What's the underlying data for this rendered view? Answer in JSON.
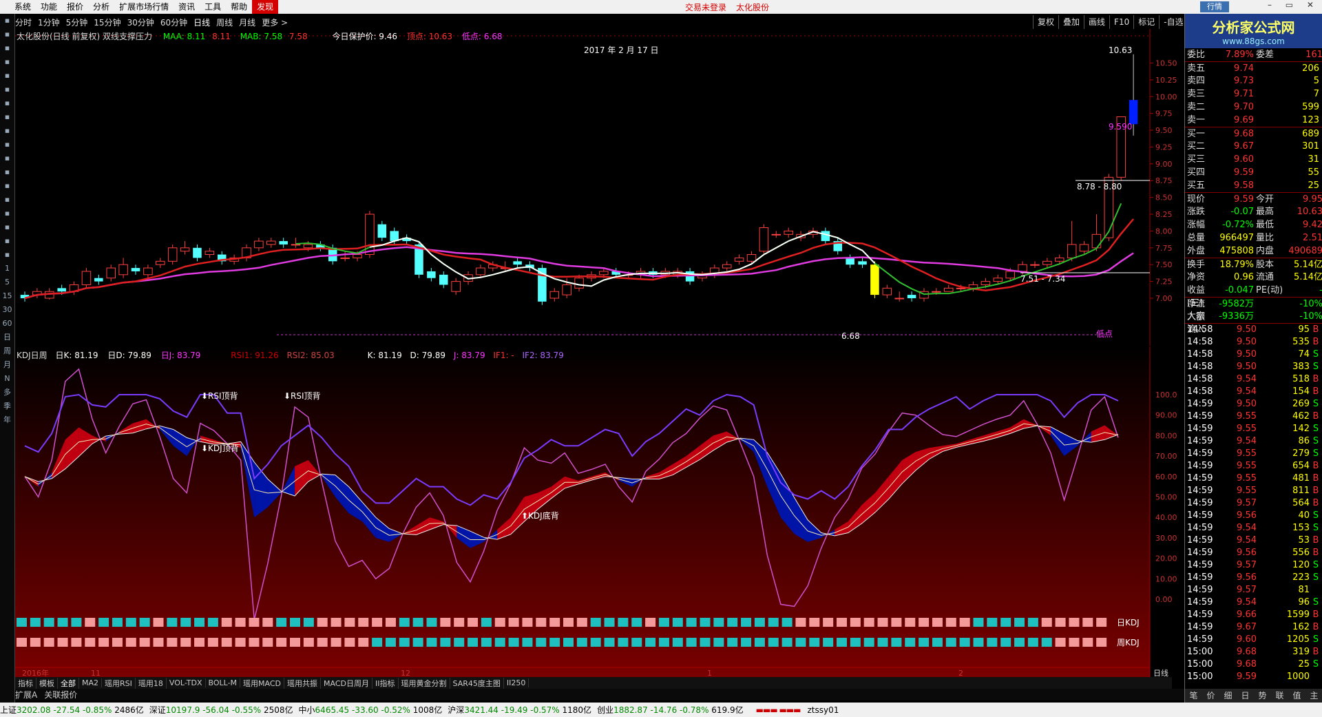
{
  "menu": {
    "items": [
      "系统",
      "功能",
      "报价",
      "分析",
      "扩展市场行情",
      "资讯",
      "工具",
      "帮助",
      "发现"
    ],
    "center": [
      "交易未登录",
      "太化股份"
    ],
    "mini": "行情"
  },
  "periods": [
    "分时",
    "1分钟",
    "5分钟",
    "15分钟",
    "30分钟",
    "60分钟",
    "日线",
    "周线",
    "月线",
    "更多 >"
  ],
  "right_buttons": [
    "复权",
    "叠加",
    "画线",
    "F10",
    "标记",
    "-自选"
  ],
  "info": {
    "name": "太化股份(日线 前复权) 双线支撑压力",
    "maa_label": "MAA:",
    "maa": "8.11",
    "maa2": "8.11",
    "mab_label": "MAB:",
    "mab": "7.58",
    "mab2": "7.58",
    "protect": "今日保护价: 9.46",
    "top": "顶点: 10.63",
    "low": "低点: 6.68"
  },
  "chart": {
    "date_label": "2017 年 2 月 17 日",
    "hi_label": "10.63",
    "cur_label": "9.590",
    "range_label": "8.78 - 8.80",
    "range2_label": "7.51 - 7.34",
    "low_label": "6.68",
    "low_tag": "低点",
    "yticks": [
      "10.50",
      "10.25",
      "10.00",
      "9.75",
      "9.50",
      "9.25",
      "9.00",
      "8.75",
      "8.50",
      "8.25",
      "8.00",
      "7.75",
      "7.50",
      "7.25",
      "7.00"
    ]
  },
  "kdj": {
    "title": "KDJ日周",
    "k": "日K: 81.19",
    "d": "日D: 79.89",
    "j": "日J: 83.79",
    "rsi1": "RSI1: 91.26",
    "rsi2": "RSI2: 85.03",
    "k2": "K: 81.19",
    "d2": "D: 79.89",
    "j2": "J: 83.79",
    "if1": "IF1: -",
    "if2": "IF2: 83.79",
    "yticks": [
      "100.0",
      "90.00",
      "80.00",
      "70.00",
      "60.00",
      "50.00",
      "40.00",
      "30.00",
      "20.00",
      "10.00",
      "0.00"
    ],
    "ann_rsi1": "RSI顶背",
    "ann_rsi2": "RSI顶背",
    "ann_kdj1": "KDJ顶背",
    "ann_kdj2": "KDJ底背",
    "day_label": "日KDJ",
    "week_label": "周KDJ",
    "x_labels": [
      "2016年",
      "11",
      "12",
      "1",
      "2"
    ],
    "period_label": "日线"
  },
  "left_tool": [
    "1",
    "5",
    "15",
    "30",
    "60",
    "日",
    "周",
    "月",
    "N",
    "多",
    "季",
    "年"
  ],
  "bottom_tabs": [
    "指标",
    "模板",
    "全部",
    "MA2",
    "瑶用RSI",
    "瑶用18",
    "VOL-TDX",
    "BOLL-M",
    "瑶用MACD",
    "瑶用共振",
    "MACD日周月",
    "II指标",
    "瑶用黄金分割",
    "SAR45度主图",
    "II250"
  ],
  "ext_bar": [
    "扩展A",
    "关联报价"
  ],
  "status": [
    {
      "name": "上证",
      "v": "3202.08",
      "c": "-27.54",
      "p": "-0.85%",
      "a": "2486亿"
    },
    {
      "name": "深证",
      "v": "10197.9",
      "c": "-56.04",
      "p": "-0.55%",
      "a": "2508亿"
    },
    {
      "name": "中小",
      "v": "6465.45",
      "c": "-33.60",
      "p": "-0.52%",
      "a": "1008亿"
    },
    {
      "name": "沪深",
      "v": "3421.44",
      "c": "-19.49",
      "p": "-0.57%",
      "a": "1180亿"
    },
    {
      "name": "创业",
      "v": "1882.87",
      "c": "-14.76",
      "p": "-0.78%",
      "a": "619.9亿"
    }
  ],
  "status_user": "ztssy01",
  "logo": {
    "a": "分析家公式网",
    "b": "www.88gs.com"
  },
  "quote": {
    "weibi": {
      "l": "委比",
      "v": "7.89%",
      "l2": "委差",
      "n": "161"
    },
    "sells": [
      {
        "l": "卖五",
        "p": "9.74",
        "v": "206"
      },
      {
        "l": "卖四",
        "p": "9.73",
        "v": "5"
      },
      {
        "l": "卖三",
        "p": "9.71",
        "v": "7"
      },
      {
        "l": "卖二",
        "p": "9.70",
        "v": "599"
      },
      {
        "l": "卖一",
        "p": "9.69",
        "v": "123"
      }
    ],
    "buys": [
      {
        "l": "买一",
        "p": "9.68",
        "v": "689"
      },
      {
        "l": "买二",
        "p": "9.67",
        "v": "301"
      },
      {
        "l": "买三",
        "p": "9.60",
        "v": "31"
      },
      {
        "l": "买四",
        "p": "9.59",
        "v": "55"
      },
      {
        "l": "买五",
        "p": "9.58",
        "v": "25"
      }
    ],
    "stats": [
      [
        "现价",
        "9.59",
        "今开",
        "9.95"
      ],
      [
        "涨跌",
        "-0.07",
        "最高",
        "10.63"
      ],
      [
        "涨幅",
        "-0.72%",
        "最低",
        "9.42"
      ],
      [
        "总量",
        "966497",
        "量比",
        "2.51"
      ],
      [
        "外盘",
        "475808",
        "内盘",
        "490689"
      ],
      [
        "换手",
        "18.79%",
        "股本",
        "5.14亿"
      ],
      [
        "净资",
        "0.96",
        "流通",
        "5.14亿"
      ],
      [
        "收益(三)",
        "-0.047",
        "PE(动)",
        "-"
      ],
      [
        "净流入额",
        "-9582万",
        "",
        "-10%"
      ],
      [
        "大宗流入",
        "-9336万",
        "",
        "-10%"
      ]
    ]
  },
  "ticks": [
    [
      "14:58",
      "9.50",
      "95",
      "B"
    ],
    [
      "14:58",
      "9.50",
      "535",
      "B"
    ],
    [
      "14:58",
      "9.50",
      "74",
      "S"
    ],
    [
      "14:58",
      "9.50",
      "383",
      "S"
    ],
    [
      "14:58",
      "9.54",
      "518",
      "B"
    ],
    [
      "14:58",
      "9.54",
      "154",
      "B"
    ],
    [
      "14:59",
      "9.50",
      "269",
      "S"
    ],
    [
      "14:59",
      "9.55",
      "462",
      "B"
    ],
    [
      "14:59",
      "9.55",
      "142",
      "S"
    ],
    [
      "14:59",
      "9.54",
      "86",
      "S"
    ],
    [
      "14:59",
      "9.55",
      "279",
      "S"
    ],
    [
      "14:59",
      "9.55",
      "654",
      "B"
    ],
    [
      "14:59",
      "9.55",
      "481",
      "B"
    ],
    [
      "14:59",
      "9.55",
      "811",
      "B"
    ],
    [
      "14:59",
      "9.57",
      "564",
      "B"
    ],
    [
      "14:59",
      "9.56",
      "40",
      "S"
    ],
    [
      "14:59",
      "9.54",
      "153",
      "S"
    ],
    [
      "14:59",
      "9.54",
      "53",
      "B"
    ],
    [
      "14:59",
      "9.56",
      "556",
      "B"
    ],
    [
      "14:59",
      "9.57",
      "120",
      "S"
    ],
    [
      "14:59",
      "9.56",
      "223",
      "S"
    ],
    [
      "14:59",
      "9.57",
      "81",
      ""
    ],
    [
      "14:59",
      "9.54",
      "96",
      "S"
    ],
    [
      "14:59",
      "9.66",
      "1599",
      "B"
    ],
    [
      "14:59",
      "9.67",
      "162",
      "B"
    ],
    [
      "14:59",
      "9.60",
      "1205",
      "S"
    ],
    [
      "15:00",
      "9.68",
      "319",
      "B"
    ],
    [
      "15:00",
      "9.68",
      "25",
      "S"
    ],
    [
      "15:00",
      "9.59",
      "1000",
      ""
    ]
  ],
  "right_tabs": [
    "笔",
    "价",
    "细",
    "日",
    "势",
    "联",
    "值",
    "主"
  ]
}
